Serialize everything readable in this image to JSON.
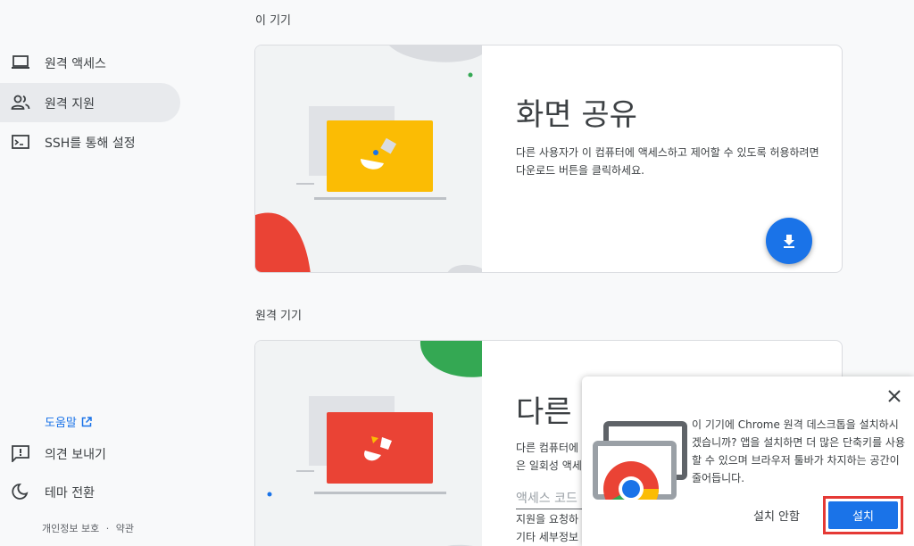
{
  "sidebar": {
    "items": [
      {
        "label": "원격 액세스",
        "icon": "laptop-icon",
        "active": false
      },
      {
        "label": "원격 지원",
        "icon": "people-icon",
        "active": true
      },
      {
        "label": "SSH를 통해 설정",
        "icon": "terminal-icon",
        "active": false
      }
    ],
    "help_label": "도움말",
    "feedback_label": "의견 보내기",
    "theme_label": "테마 전환",
    "privacy_label": "개인정보 보호",
    "terms_label": "약관",
    "separator": "·"
  },
  "main": {
    "this_device_title": "이 기기",
    "share_card": {
      "title": "화면 공유",
      "description": "다른 사용자가 이 컴퓨터에 액세스하고 제어할 수 있도록 허용하려면 다운로드 버튼을 클릭하세요."
    },
    "remote_device_title": "원격 기기",
    "connect_card": {
      "title": "다른",
      "description_line1": "다른 컴퓨터에",
      "description_line2": "은 일회성 액세",
      "code_placeholder": "액세스 코드",
      "help_line1": "지원을 요청하",
      "help_line2": "기타 세부정보"
    }
  },
  "popup": {
    "message": "이 기기에 Chrome 원격 데스크톱을 설치하시겠습니까? 앱을 설치하면 더 많은 단축키를 사용할 수 있으며 브라우저 툴바가 차지하는 공간이 줄어듭니다.",
    "cancel_label": "설치 안함",
    "install_label": "설치"
  },
  "colors": {
    "accent": "#1a73e8",
    "yellow": "#fbbc04",
    "red": "#ea4335",
    "green": "#34a853",
    "highlight_border": "#e53935"
  }
}
